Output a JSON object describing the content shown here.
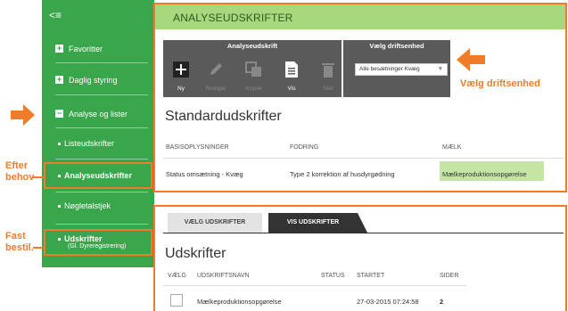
{
  "sidebar": {
    "back_label": "<≡",
    "items": [
      {
        "label": "Favoritter",
        "marker": "+"
      },
      {
        "label": "Daglig styring",
        "marker": "+"
      },
      {
        "label": "Analyse og lister",
        "marker": "−"
      },
      {
        "label": "Listeudskrifter",
        "marker": "•"
      },
      {
        "label": "Analyseudskrifter",
        "marker": "•"
      },
      {
        "label": "Nøgletalstjek",
        "marker": "•"
      },
      {
        "label": "Udskrifter",
        "sublabel": "(Gl. Dyreregistrering)",
        "marker": "•"
      }
    ]
  },
  "annotations": {
    "efter_behov_line1": "Efter",
    "efter_behov_line2": "behov",
    "fast_bestil_line1": "Fast",
    "fast_bestil_line2": "bestil.",
    "valg_driftsenhed": "Vælg driftsenhed"
  },
  "header": {
    "title": "ANALYSEUDSKRIFTER"
  },
  "toolbar": {
    "group1_title": "Analyseudskrift",
    "group2_title": "Vælg driftsenhed",
    "tools": [
      {
        "label": "Ny",
        "icon": "plus-icon"
      },
      {
        "label": "Rediger",
        "icon": "pencil-icon"
      },
      {
        "label": "Kopier",
        "icon": "copy-icon"
      },
      {
        "label": "Vis",
        "icon": "document-icon"
      },
      {
        "label": "Slet",
        "icon": "trash-icon"
      }
    ],
    "select_value": "Alle besætninger Kvæg"
  },
  "standard": {
    "title": "Standardudskrifter",
    "columns": [
      "BASISOPLYSNINGER",
      "FODRING",
      "MÆLK"
    ],
    "row": [
      "Status omsætning - Kvæg",
      "Type 2 korrektion af husdyrgødning",
      "Mælkeproduktionsopgørelse"
    ]
  },
  "lower": {
    "tabs": [
      "VÆLG UDSKRIFTER",
      "VIS UDSKRIFTER"
    ],
    "title": "Udskrifter",
    "columns": [
      "VÆLG",
      "UDSKRIFTSNAVN",
      "STATUS",
      "STARTET",
      "SIDER"
    ],
    "row": {
      "name": "Mælkeproduktionsopgørelse",
      "status": "",
      "started": "27-03-2015 07:24:58",
      "pages": "2"
    }
  },
  "colors": {
    "accent": "#f07c2a",
    "sidebar": "#3aa64c",
    "header": "#a6d87e",
    "toolbar": "#5a5a5a"
  }
}
